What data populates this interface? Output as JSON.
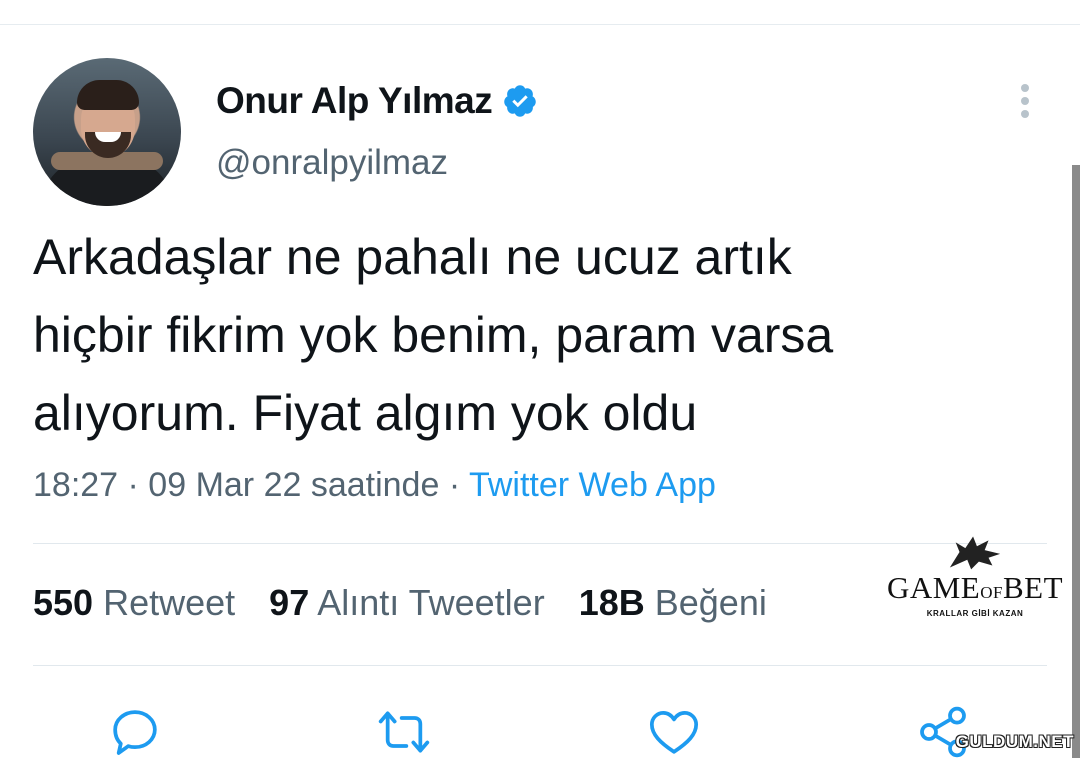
{
  "author": {
    "display_name": "Onur Alp Yılmaz",
    "handle": "@onralpyilmaz",
    "verified": true
  },
  "tweet": {
    "lines": [
      "Arkadaşlar ne pahalı ne ucuz artık",
      "hiçbir fikrim yok benim, param varsa",
      "alıyorum. Fiyat algım yok oldu"
    ],
    "time": "18:27 · 09 Mar 22 saatinde · ",
    "source": "Twitter Web App"
  },
  "stats": {
    "retweets": {
      "count": "550",
      "label": "Retweet"
    },
    "quotes": {
      "count": "97",
      "label": "Alıntı Tweetler"
    },
    "likes": {
      "count": "18B",
      "label": "Beğeni"
    }
  },
  "watermark": {
    "brand_left": "GAME",
    "brand_of": "OF",
    "brand_right": "BET",
    "tagline": "KRALLAR GİBİ KAZAN",
    "site": "GULDUM.NET"
  },
  "icons": [
    "verified-icon",
    "more-icon",
    "reply-icon",
    "retweet-icon",
    "like-icon",
    "share-icon",
    "wolf-logo-icon"
  ],
  "colors": {
    "accent": "#1d9bf0",
    "secondary_text": "#536471",
    "icon": "#1d9bf0"
  }
}
